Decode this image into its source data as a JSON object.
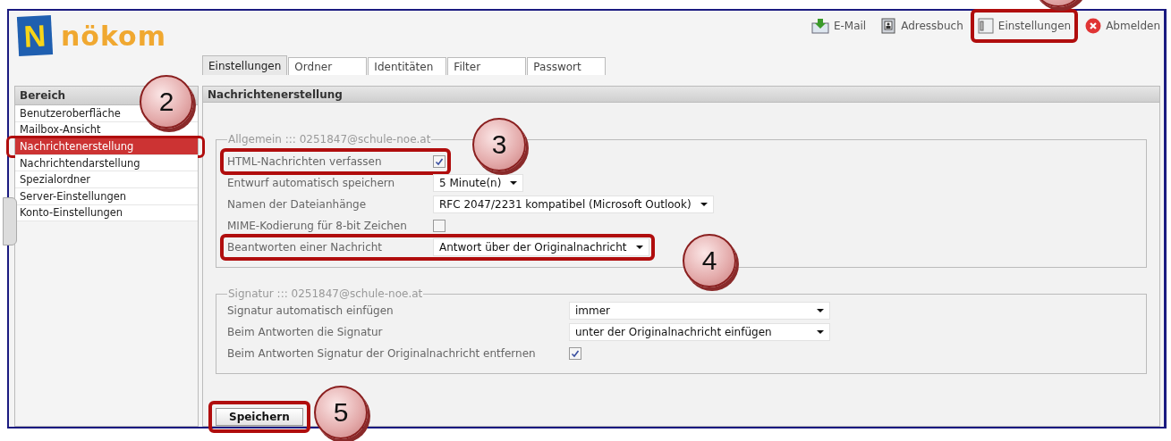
{
  "header": {
    "logo_mark": "N",
    "logo_text": "nökom",
    "links": [
      {
        "label": "E-Mail",
        "kind": "mail",
        "highlighted": false
      },
      {
        "label": "Adressbuch",
        "kind": "addressbook",
        "highlighted": false
      },
      {
        "label": "Einstellungen",
        "kind": "settings",
        "highlighted": true
      },
      {
        "label": "Abmelden",
        "kind": "logout",
        "highlighted": false
      }
    ]
  },
  "tabs": [
    {
      "label": "Einstellungen",
      "selected": true
    },
    {
      "label": "Ordner",
      "selected": false
    },
    {
      "label": "Identitäten",
      "selected": false
    },
    {
      "label": "Filter",
      "selected": false
    },
    {
      "label": "Passwort",
      "selected": false
    }
  ],
  "sidebar": {
    "title": "Bereich",
    "items": [
      {
        "label": "Benutzeroberfläche",
        "selected": false,
        "highlighted": false
      },
      {
        "label": "Mailbox-Ansicht",
        "selected": false,
        "highlighted": false
      },
      {
        "label": "Nachrichtenerstellung",
        "selected": true,
        "highlighted": true
      },
      {
        "label": "Nachrichtendarstellung",
        "selected": false,
        "highlighted": false
      },
      {
        "label": "Spezialordner",
        "selected": false,
        "highlighted": false
      },
      {
        "label": "Server-Einstellungen",
        "selected": false,
        "highlighted": false
      },
      {
        "label": "Konto-Einstellungen",
        "selected": false,
        "highlighted": false
      }
    ]
  },
  "panel": {
    "title": "Nachrichtenerstellung",
    "sections": [
      {
        "legend": "Allgemein ::: 0251847@schule-noe.at",
        "rows": [
          {
            "label": "HTML-Nachrichten verfassen",
            "kind": "checkbox",
            "checked": true,
            "highlighted": true
          },
          {
            "label": "Entwurf automatisch speichern",
            "kind": "select",
            "value": "5 Minute(n)",
            "highlighted": false
          },
          {
            "label": "Namen der Dateianhänge",
            "kind": "select",
            "value": "RFC 2047/2231 kompatibel (Microsoft Outlook)",
            "highlighted": false
          },
          {
            "label": "MIME-Kodierung für 8-bit Zeichen",
            "kind": "checkbox",
            "checked": false,
            "highlighted": false
          },
          {
            "label": "Beantworten einer Nachricht",
            "kind": "select",
            "value": "Antwort über der Originalnachricht",
            "highlighted": true
          }
        ]
      },
      {
        "legend": "Signatur ::: 0251847@schule-noe.at",
        "rows": [
          {
            "label": "Signatur automatisch einfügen",
            "kind": "select",
            "value": "immer",
            "highlighted": false
          },
          {
            "label": "Beim Antworten die Signatur",
            "kind": "select",
            "value": "unter der Originalnachricht einfügen",
            "highlighted": false
          },
          {
            "label": "Beim Antworten Signatur der Originalnachricht entfernen",
            "kind": "checkbox",
            "checked": true,
            "highlighted": false
          }
        ]
      }
    ],
    "save_button": {
      "label": "Speichern",
      "highlighted": true
    }
  },
  "callouts": [
    {
      "number": "2"
    },
    {
      "number": "3"
    },
    {
      "number": "4"
    },
    {
      "number": "5"
    }
  ]
}
